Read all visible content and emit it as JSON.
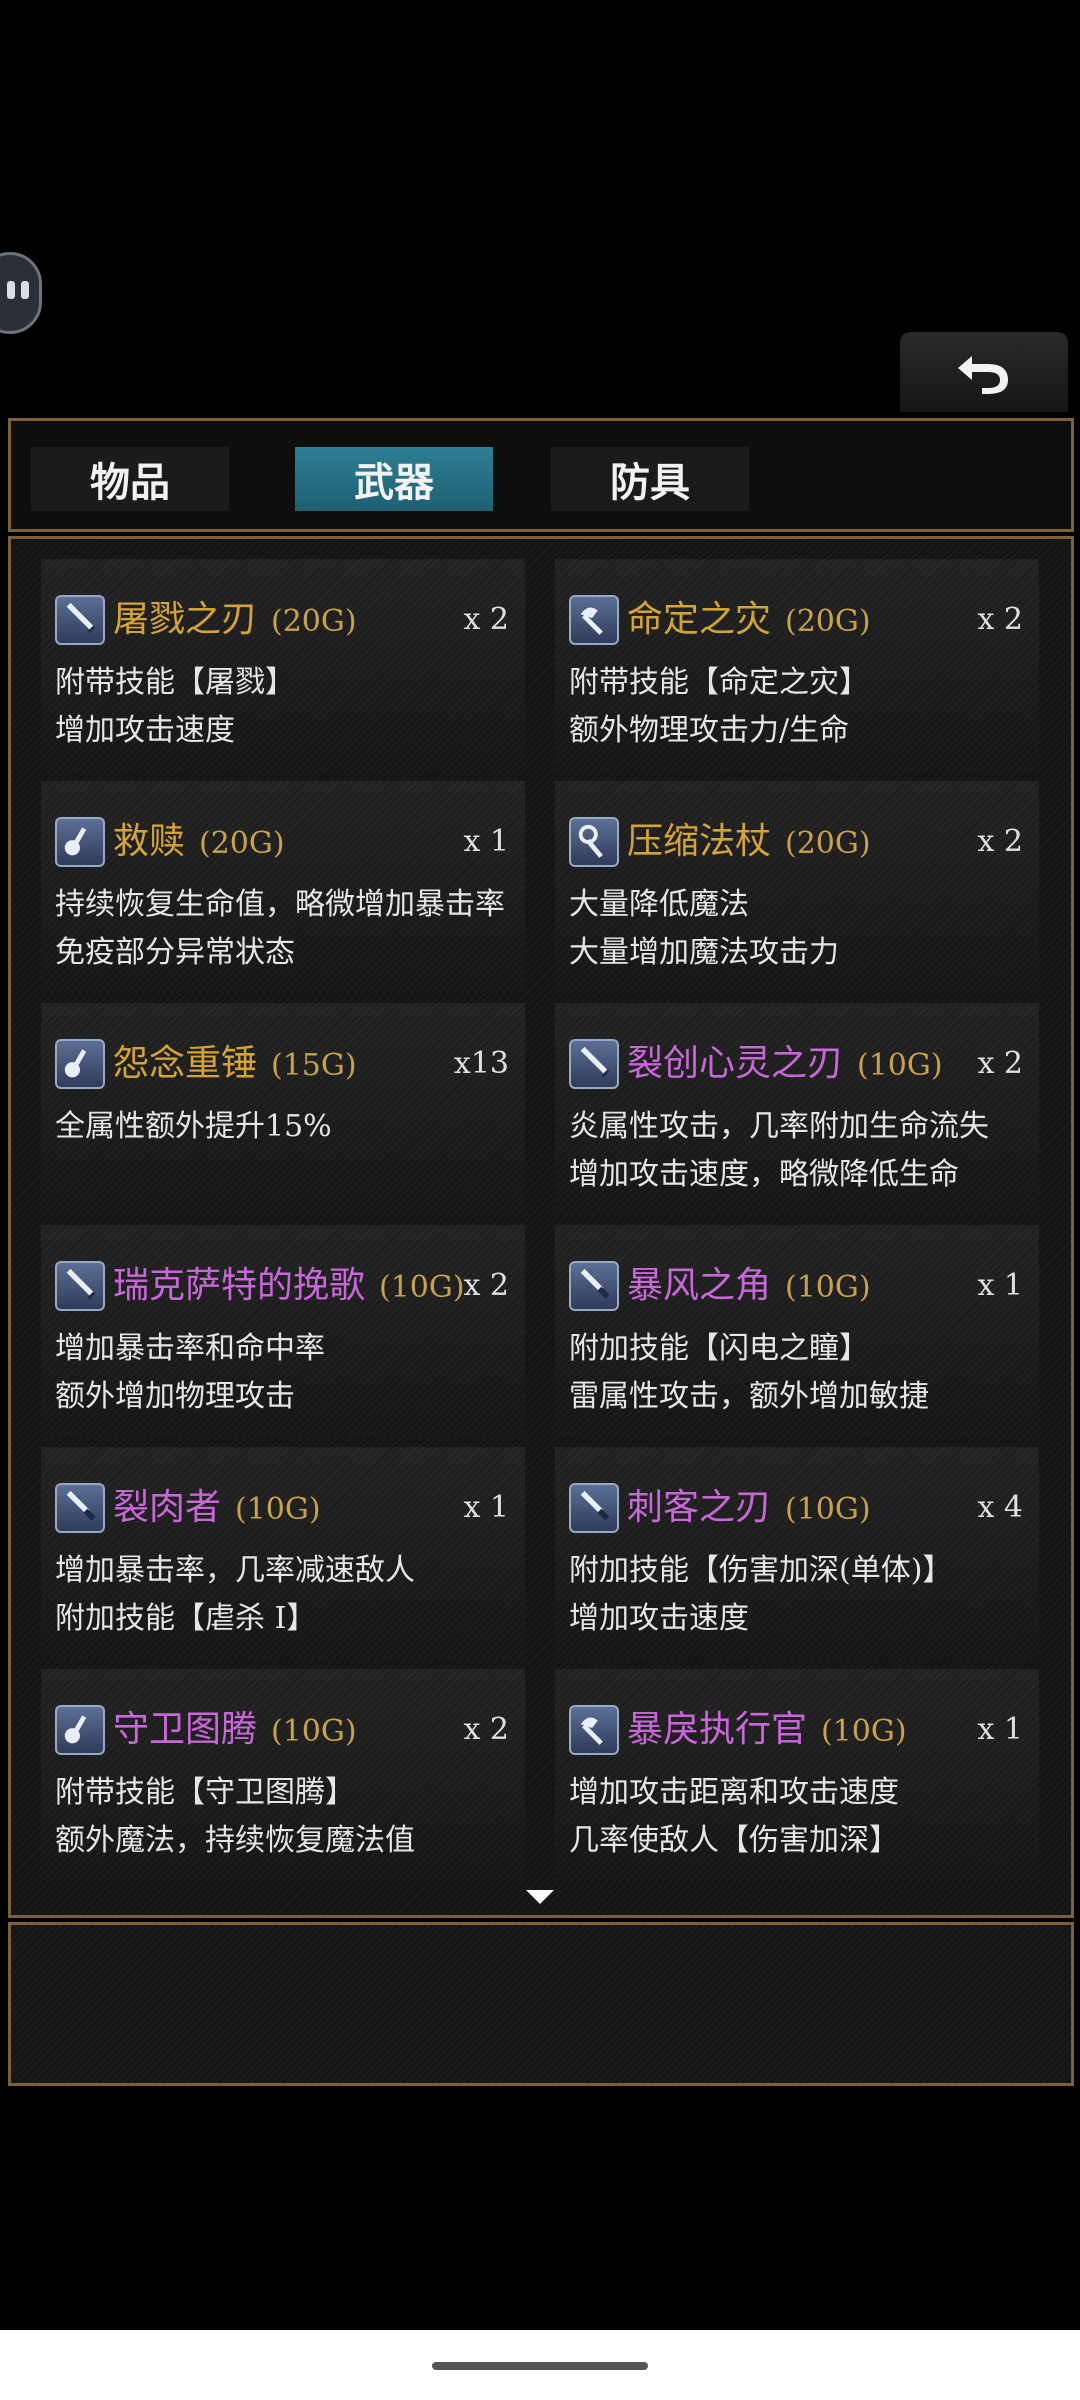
{
  "tabs": [
    {
      "label": "物品",
      "active": false
    },
    {
      "label": "武器",
      "active": true
    },
    {
      "label": "防具",
      "active": false
    }
  ],
  "colors": {
    "legendary": "#d4a437",
    "epic": "#c867d8",
    "price": "#c9a24a",
    "tab_active": "#2e7f95"
  },
  "items": [
    {
      "name": "屠戮之刃",
      "price": "(20G)",
      "count": "x 2",
      "rarity": "legendary",
      "icon": "sword-icon",
      "desc": [
        "附带技能【屠戮】",
        "增加攻击速度"
      ]
    },
    {
      "name": "命定之灾",
      "price": "(20G)",
      "count": "x 2",
      "rarity": "legendary",
      "icon": "axe-icon",
      "desc": [
        "附带技能【命定之灾】",
        "额外物理攻击力/生命"
      ]
    },
    {
      "name": "救赎",
      "price": "(20G)",
      "count": "x 1",
      "rarity": "legendary",
      "icon": "mace-icon",
      "desc": [
        "持续恢复生命值，略微增加暴击率",
        "免疫部分异常状态"
      ]
    },
    {
      "name": "压缩法杖",
      "price": "(20G)",
      "count": "x 2",
      "rarity": "legendary",
      "icon": "staff-icon",
      "desc": [
        "大量降低魔法",
        "大量增加魔法攻击力"
      ]
    },
    {
      "name": "怨念重锤",
      "price": "(15G)",
      "count": "x13",
      "rarity": "legendary",
      "icon": "mace-icon",
      "desc": [
        "全属性额外提升15%",
        ""
      ]
    },
    {
      "name": "裂创心灵之刃",
      "price": "(10G)",
      "count": "x 2",
      "rarity": "epic",
      "icon": "sword-icon",
      "desc": [
        "炎属性攻击，几率附加生命流失",
        "增加攻击速度，略微降低生命"
      ]
    },
    {
      "name": "瑞克萨特的挽歌",
      "price": "(10G)",
      "count": "x 2",
      "rarity": "epic",
      "icon": "sword-icon",
      "desc": [
        "增加暴击率和命中率",
        "额外增加物理攻击"
      ]
    },
    {
      "name": "暴风之角",
      "price": "(10G)",
      "count": "x 1",
      "rarity": "epic",
      "icon": "dagger-icon",
      "desc": [
        "附加技能【闪电之瞳】",
        "雷属性攻击，额外增加敏捷"
      ]
    },
    {
      "name": "裂肉者",
      "price": "(10G)",
      "count": "x 1",
      "rarity": "epic",
      "icon": "dagger-icon",
      "desc": [
        "增加暴击率，几率减速敌人",
        "附加技能【虐杀 I】"
      ]
    },
    {
      "name": "刺客之刃",
      "price": "(10G)",
      "count": "x 4",
      "rarity": "epic",
      "icon": "dagger-icon",
      "desc": [
        "附加技能【伤害加深(单体)】",
        "增加攻击速度"
      ]
    },
    {
      "name": "守卫图腾",
      "price": "(10G)",
      "count": "x 2",
      "rarity": "epic",
      "icon": "mace-icon",
      "desc": [
        "附带技能【守卫图腾】",
        "额外魔法，持续恢复魔法值"
      ]
    },
    {
      "name": "暴戾执行官",
      "price": "(10G)",
      "count": "x 1",
      "rarity": "epic",
      "icon": "axe-icon",
      "desc": [
        "增加攻击距离和攻击速度",
        "几率使敌人【伤害加深】"
      ]
    }
  ]
}
